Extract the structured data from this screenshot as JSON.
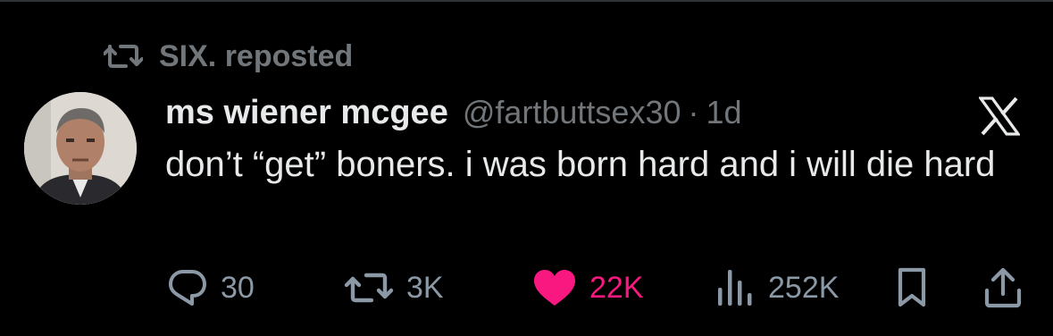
{
  "repost": {
    "label": "SIX. reposted"
  },
  "tweet": {
    "display_name": "ms wiener mcgee",
    "handle": "@fartbuttsex30",
    "separator": "·",
    "time": "1d",
    "text": "don’t “get” boners. i was born hard and i will die hard"
  },
  "actions": {
    "replies": "30",
    "reposts": "3K",
    "likes": "22K",
    "views": "252K"
  },
  "icons": {
    "repost": "repost-icon",
    "reply": "reply-icon",
    "like": "heart-icon",
    "views": "views-chart-icon",
    "bookmark": "bookmark-icon",
    "share": "share-icon",
    "logo": "x-logo-icon"
  },
  "colors": {
    "background": "#000000",
    "text": "#e7e9ea",
    "secondary": "#71767b",
    "like": "#f91880"
  }
}
